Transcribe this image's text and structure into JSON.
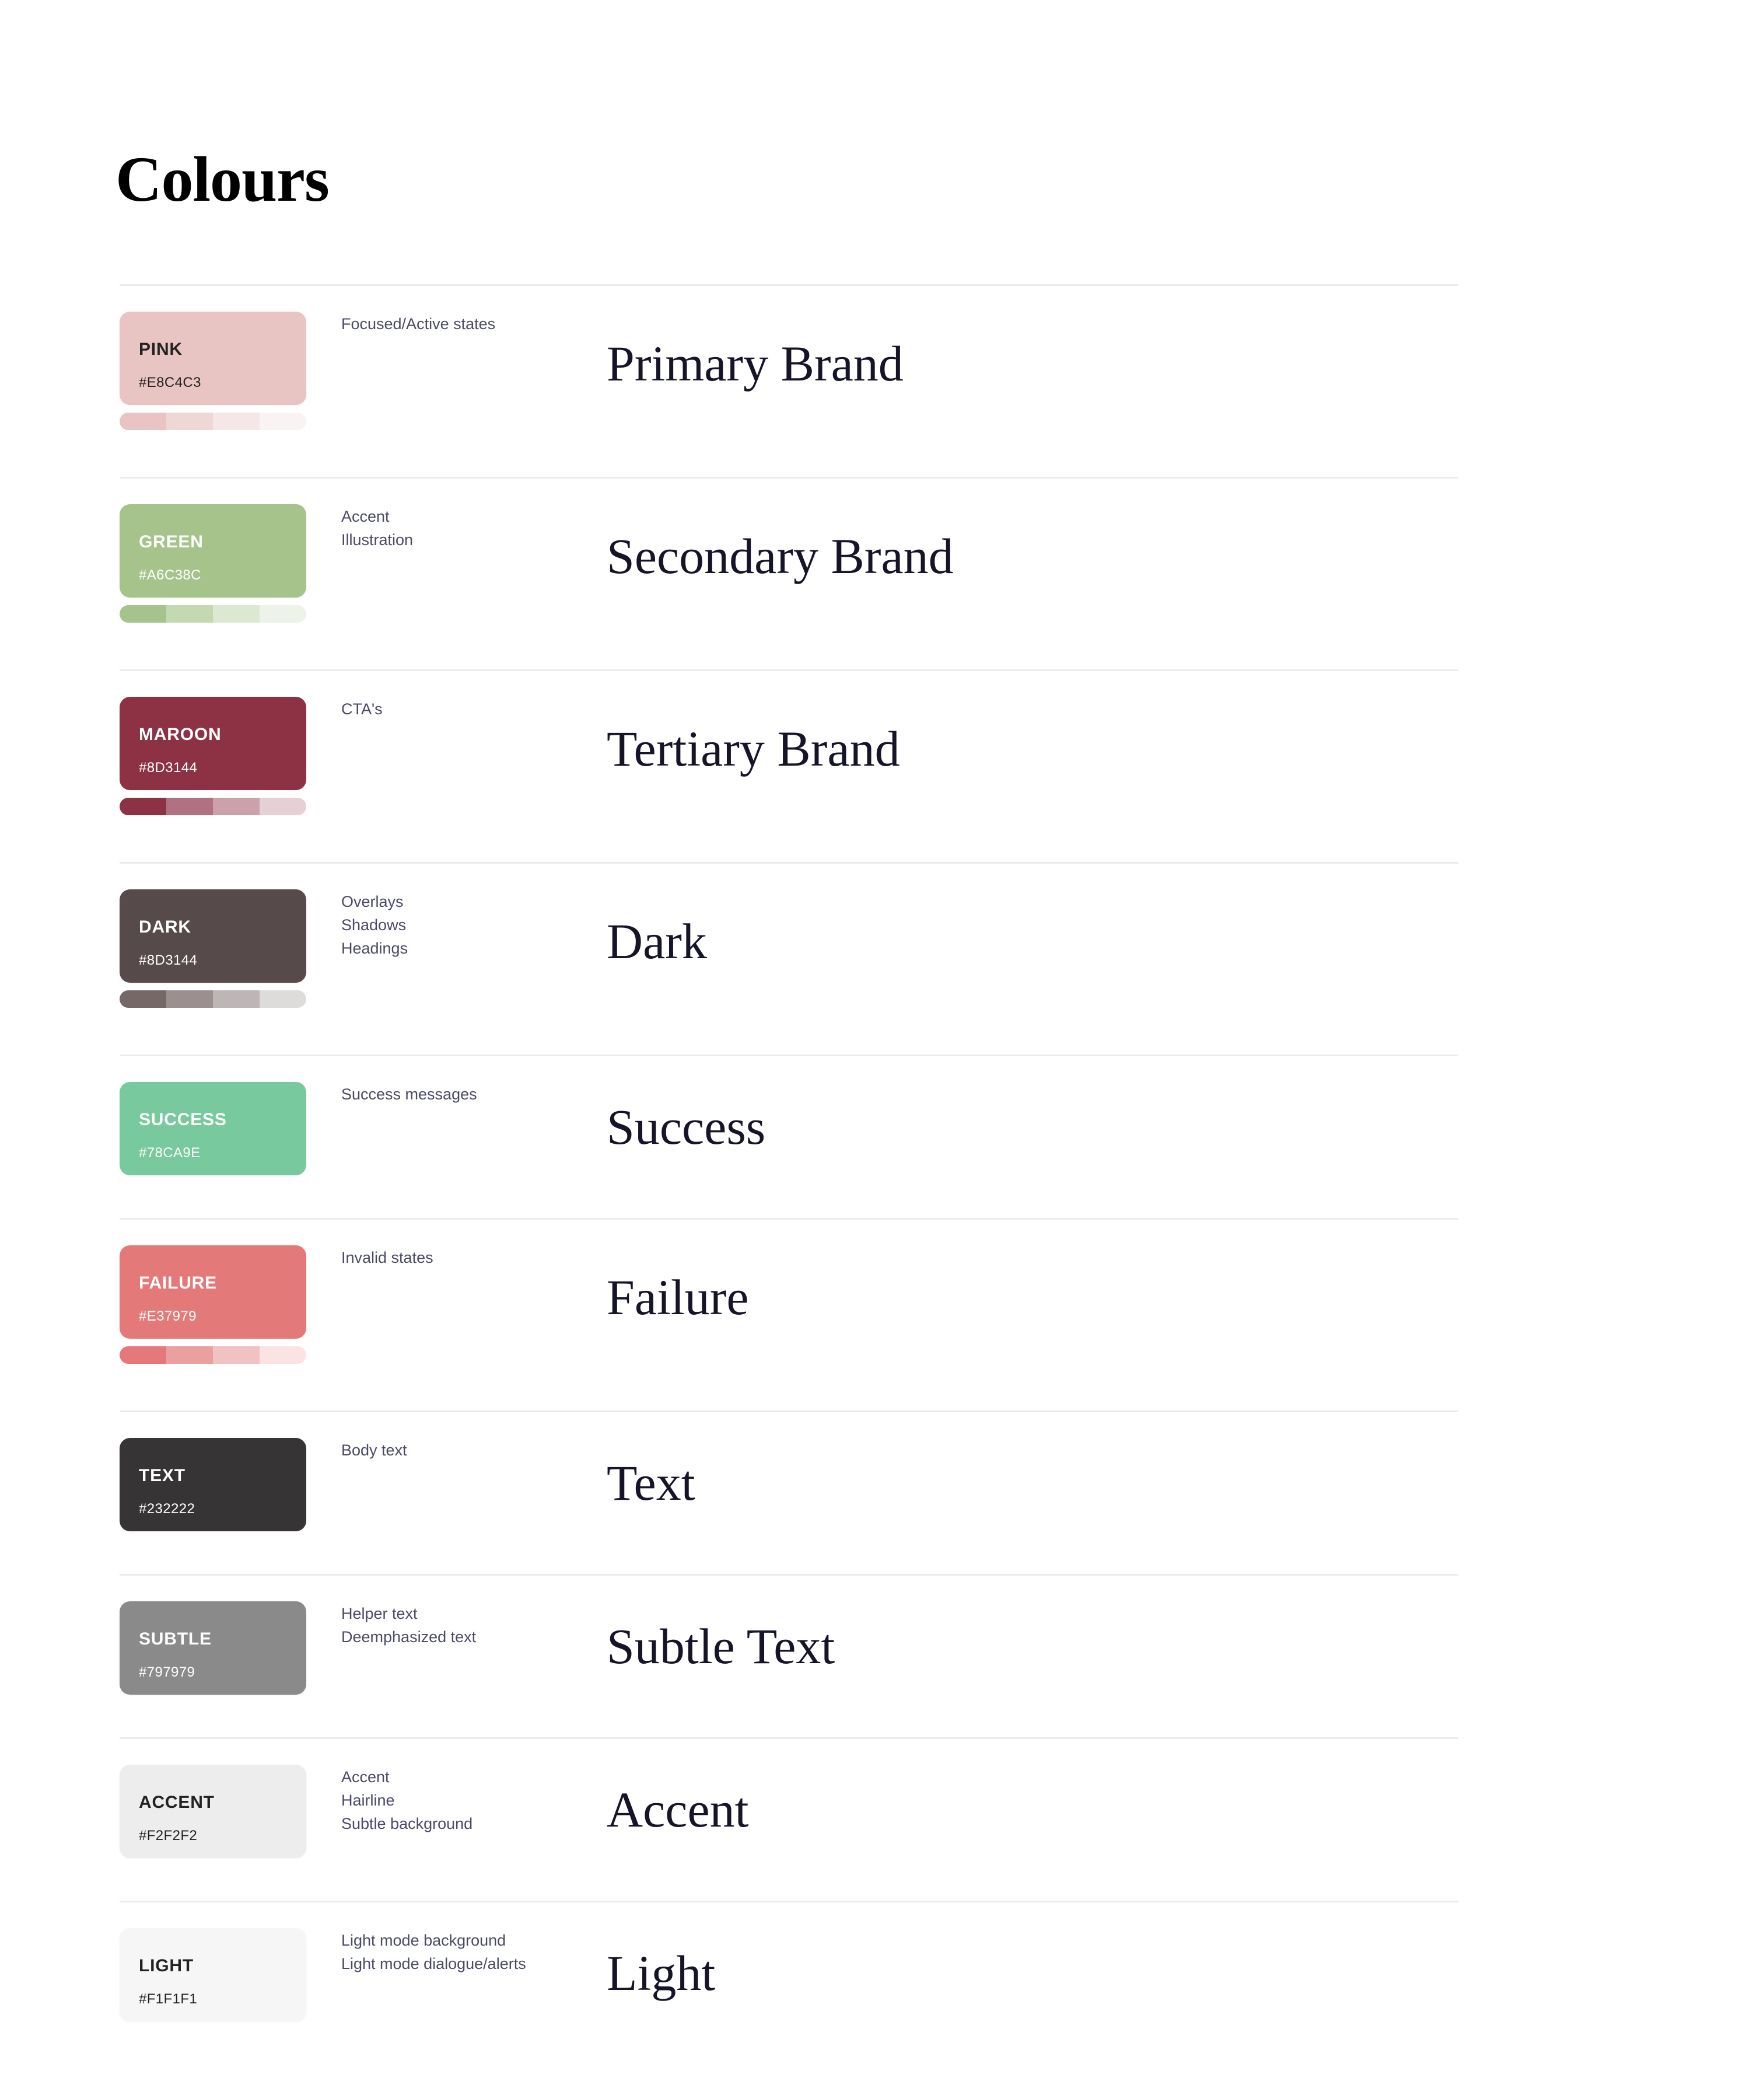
{
  "page": {
    "title": "Colours",
    "background": "#FFFFFF",
    "divider_color": "#E9ECEF",
    "heading_color": "#151428",
    "usage_text_color": "#4A4A68"
  },
  "rows": [
    {
      "swatch_label": "PINK",
      "hex": "#E8C4C3",
      "swatch_bg": "#E8C4C3",
      "swatch_text_color": "#232222",
      "usages": [
        "Focused/Active states"
      ],
      "display_name": "Primary Brand",
      "tints": [
        "#E8C4C3",
        "#EFD7D6",
        "#F5E7E7",
        "#FAF3F3"
      ],
      "has_tints": true
    },
    {
      "swatch_label": "GREEN",
      "hex": "#A6C38C",
      "swatch_bg": "#A6C38C",
      "swatch_text_color": "#FFFFFF",
      "usages": [
        "Accent",
        "Illustration"
      ],
      "display_name": "Secondary Brand",
      "tints": [
        "#A6C38C",
        "#C4D8B2",
        "#DCE8D1",
        "#EDF3E8"
      ],
      "has_tints": true
    },
    {
      "swatch_label": "MAROON",
      "hex": "#8D3144",
      "swatch_bg": "#8D3144",
      "swatch_text_color": "#FFFFFF",
      "usages": [
        "CTA's"
      ],
      "display_name": "Tertiary Brand",
      "tints": [
        "#8D3144",
        "#B07282",
        "#CBA1AC",
        "#E4D0D5"
      ],
      "has_tints": true
    },
    {
      "swatch_label": "DARK",
      "hex": "#8D3144",
      "swatch_bg": "#564A4A",
      "swatch_text_color": "#FFFFFF",
      "usages": [
        "Overlays",
        "Shadows",
        "Headings"
      ],
      "display_name": "Dark",
      "tints": [
        "#776868",
        "#9B8F8F",
        "#BEB6B6",
        "#DEDBDB"
      ],
      "has_tints": true
    },
    {
      "swatch_label": "SUCCESS",
      "hex": "#78CA9E",
      "swatch_bg": "#78CA9E",
      "swatch_text_color": "#FFFFFF",
      "usages": [
        "Success messages"
      ],
      "display_name": "Success",
      "tints": [],
      "has_tints": false
    },
    {
      "swatch_label": "FAILURE",
      "hex": "#E37979",
      "swatch_bg": "#E37979",
      "swatch_text_color": "#FFFFFF",
      "usages": [
        "Invalid states"
      ],
      "display_name": "Failure",
      "tints": [
        "#E37979",
        "#EBA0A0",
        "#F1C2C2",
        "#F9E3E3"
      ],
      "has_tints": true
    },
    {
      "swatch_label": "TEXT",
      "hex": "#232222",
      "swatch_bg": "#363434",
      "swatch_text_color": "#FFFFFF",
      "usages": [
        "Body text"
      ],
      "display_name": "Text",
      "tints": [],
      "has_tints": false
    },
    {
      "swatch_label": "SUBTLE",
      "hex": "#797979",
      "swatch_bg": "#8A8A8A",
      "swatch_text_color": "#FFFFFF",
      "usages": [
        "Helper text",
        "Deemphasized text"
      ],
      "display_name": "Subtle Text",
      "tints": [],
      "has_tints": false
    },
    {
      "swatch_label": "ACCENT",
      "hex": "#F2F2F2",
      "swatch_bg": "#EDEDED",
      "swatch_text_color": "#232222",
      "usages": [
        "Accent",
        "Hairline",
        "Subtle background"
      ],
      "display_name": "Accent",
      "tints": [],
      "has_tints": false
    },
    {
      "swatch_label": "LIGHT",
      "hex": "#F1F1F1",
      "swatch_bg": "#F6F6F6",
      "swatch_text_color": "#232222",
      "usages": [
        "Light mode background",
        "Light mode dialogue/alerts"
      ],
      "display_name": "Light",
      "tints": [],
      "has_tints": false
    }
  ]
}
